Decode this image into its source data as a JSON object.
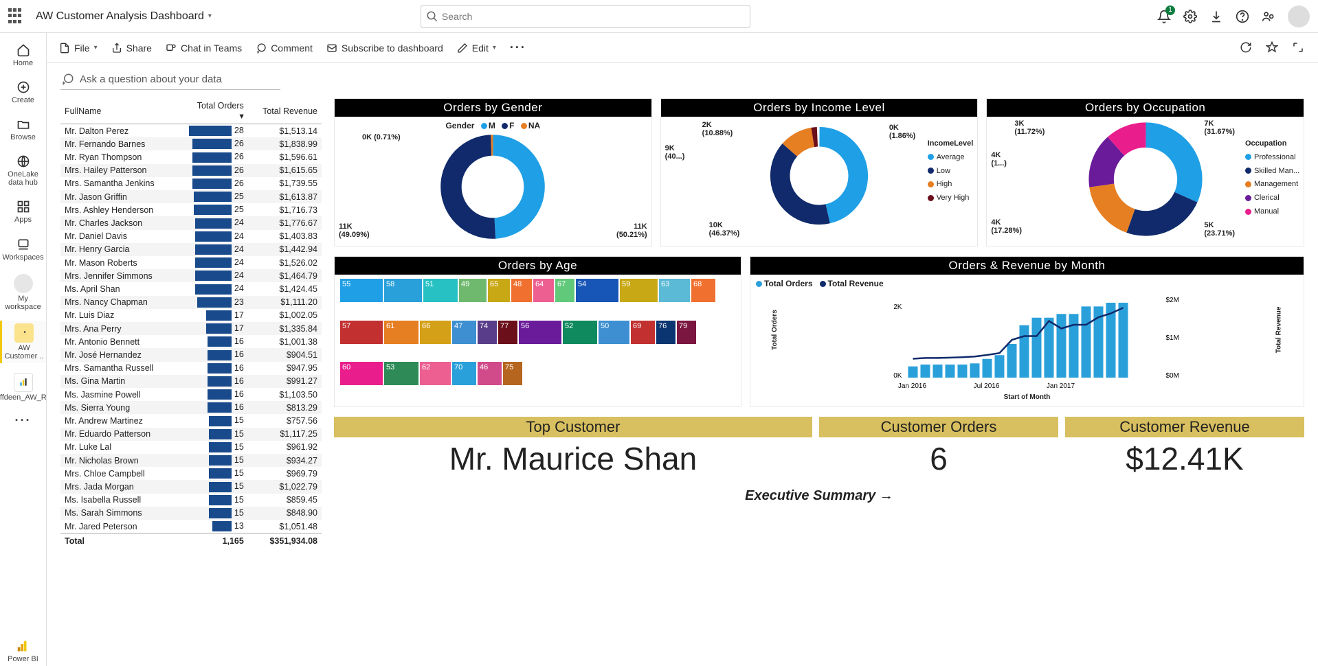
{
  "header": {
    "title": "AW Customer Analysis Dashboard",
    "search_placeholder": "Search",
    "notif_count": "1"
  },
  "leftnav": {
    "home": "Home",
    "create": "Create",
    "browse": "Browse",
    "onelake": "OneLake data hub",
    "apps": "Apps",
    "workspaces": "Workspaces",
    "myws": "My workspace",
    "aw": "AW Customer ..",
    "rep": "Sheriffdeen_AW_Report",
    "powerbi": "Power BI"
  },
  "cmd": {
    "file": "File",
    "share": "Share",
    "chat": "Chat in Teams",
    "comment": "Comment",
    "subscribe": "Subscribe to dashboard",
    "edit": "Edit"
  },
  "qa": "Ask a question about your data",
  "table": {
    "h1": "FullName",
    "h2": "Total Orders",
    "h3": "Total Revenue",
    "rows": [
      [
        "Mr. Dalton Perez",
        "28",
        "$1,513.14"
      ],
      [
        "Mr. Fernando Barnes",
        "26",
        "$1,838.99"
      ],
      [
        "Mr. Ryan Thompson",
        "26",
        "$1,596.61"
      ],
      [
        "Mrs. Hailey Patterson",
        "26",
        "$1,615.65"
      ],
      [
        "Mrs. Samantha Jenkins",
        "26",
        "$1,739.55"
      ],
      [
        "Mr. Jason Griffin",
        "25",
        "$1,613.87"
      ],
      [
        "Mrs. Ashley Henderson",
        "25",
        "$1,716.73"
      ],
      [
        "Mr. Charles Jackson",
        "24",
        "$1,776.67"
      ],
      [
        "Mr. Daniel Davis",
        "24",
        "$1,403.83"
      ],
      [
        "Mr. Henry Garcia",
        "24",
        "$1,442.94"
      ],
      [
        "Mr. Mason Roberts",
        "24",
        "$1,526.02"
      ],
      [
        "Mrs. Jennifer Simmons",
        "24",
        "$1,464.79"
      ],
      [
        "Ms. April Shan",
        "24",
        "$1,424.45"
      ],
      [
        "Mrs. Nancy Chapman",
        "23",
        "$1,111.20"
      ],
      [
        "Mr. Luis Diaz",
        "17",
        "$1,002.05"
      ],
      [
        "Mrs. Ana Perry",
        "17",
        "$1,335.84"
      ],
      [
        "Mr. Antonio Bennett",
        "16",
        "$1,001.38"
      ],
      [
        "Mr. José Hernandez",
        "16",
        "$904.51"
      ],
      [
        "Mrs. Samantha Russell",
        "16",
        "$947.95"
      ],
      [
        "Ms. Gina Martin",
        "16",
        "$991.27"
      ],
      [
        "Ms. Jasmine Powell",
        "16",
        "$1,103.50"
      ],
      [
        "Ms. Sierra Young",
        "16",
        "$813.29"
      ],
      [
        "Mr. Andrew Martinez",
        "15",
        "$757.56"
      ],
      [
        "Mr. Eduardo Patterson",
        "15",
        "$1,117.25"
      ],
      [
        "Mr. Luke Lal",
        "15",
        "$961.92"
      ],
      [
        "Mr. Nicholas Brown",
        "15",
        "$934.27"
      ],
      [
        "Mrs. Chloe Campbell",
        "15",
        "$969.79"
      ],
      [
        "Mrs. Jada Morgan",
        "15",
        "$1,022.79"
      ],
      [
        "Ms. Isabella Russell",
        "15",
        "$859.45"
      ],
      [
        "Ms. Sarah Simmons",
        "15",
        "$848.90"
      ],
      [
        "Mr. Jared Peterson",
        "13",
        "$1,051.48"
      ]
    ],
    "total_label": "Total",
    "total_orders": "1,165",
    "total_rev": "$351,934.08"
  },
  "titles": {
    "gender": "Orders by Gender",
    "income": "Orders by Income Level",
    "occ": "Orders by Occupation",
    "age": "Orders by Age",
    "combo": "Orders & Revenue by Month"
  },
  "gender_legend_label": "Gender",
  "gender_legend": {
    "m": "M",
    "f": "F",
    "na": "NA"
  },
  "gender_labels": {
    "m": "11K\n(49.09%)",
    "f": "11K\n(50.21%)",
    "na": "0K (0.71%)"
  },
  "income_legend_title": "IncomeLevel",
  "income_legend": {
    "avg": "Average",
    "low": "Low",
    "high": "High",
    "vhigh": "Very High"
  },
  "income_labels": {
    "avg": "10K\n(46.37%)",
    "low": "9K\n(40...)",
    "high": "2K\n(10.88%)",
    "vhigh": "0K\n(1.86%)"
  },
  "occ_legend_title": "Occupation",
  "occ_legend": {
    "prof": "Professional",
    "skilled": "Skilled Man...",
    "mgmt": "Management",
    "cler": "Clerical",
    "man": "Manual"
  },
  "occ_labels": {
    "prof": "7K\n(31.67%)",
    "skilled": "5K\n(23.71%)",
    "mgmt": "4K\n(17.28%)",
    "cler": "4K\n(1...)",
    "man": "3K\n(11.72%)"
  },
  "treemap_ages": [
    "55",
    "58",
    "51",
    "49",
    "65",
    "48",
    "64",
    "67",
    "54",
    "59",
    "63",
    "68",
    "57",
    "61",
    "66",
    "47",
    "74",
    "77",
    "56",
    "52",
    "50",
    "69",
    "76",
    "79",
    "60",
    "53",
    "62",
    "70",
    "46",
    "75"
  ],
  "combo": {
    "legend_orders": "Total Orders",
    "legend_rev": "Total Revenue",
    "y1_ticks": [
      "0K",
      "2K"
    ],
    "y2_ticks": [
      "$0M",
      "$1M",
      "$2M"
    ],
    "x_ticks": [
      "Jan 2016",
      "Jul 2016",
      "Jan 2017"
    ],
    "xlabel": "Start of Month",
    "y1label": "Total Orders",
    "y2label": "Total Revenue"
  },
  "gold": {
    "top_title": "Top Customer",
    "top_val": "Mr. Maurice Shan",
    "orders_title": "Customer Orders",
    "orders_val": "6",
    "rev_title": "Customer Revenue",
    "rev_val": "$12.41K",
    "exec": "Executive Summary"
  },
  "chart_data": [
    {
      "type": "pie",
      "title": "Orders by Gender",
      "series": [
        {
          "name": "M",
          "value": 11000,
          "pct": 49.09
        },
        {
          "name": "F",
          "value": 11000,
          "pct": 50.21
        },
        {
          "name": "NA",
          "value": 0,
          "pct": 0.71
        }
      ]
    },
    {
      "type": "pie",
      "title": "Orders by Income Level",
      "series": [
        {
          "name": "Average",
          "value": 10000,
          "pct": 46.37
        },
        {
          "name": "Low",
          "value": 9000,
          "pct": 40.0
        },
        {
          "name": "High",
          "value": 2000,
          "pct": 10.88
        },
        {
          "name": "Very High",
          "value": 0,
          "pct": 1.86
        }
      ]
    },
    {
      "type": "pie",
      "title": "Orders by Occupation",
      "series": [
        {
          "name": "Professional",
          "value": 7000,
          "pct": 31.67
        },
        {
          "name": "Skilled Manual",
          "value": 5000,
          "pct": 23.71
        },
        {
          "name": "Management",
          "value": 4000,
          "pct": 17.28
        },
        {
          "name": "Clerical",
          "value": 4000,
          "pct": 15.62
        },
        {
          "name": "Manual",
          "value": 3000,
          "pct": 11.72
        }
      ]
    },
    {
      "type": "treemap",
      "title": "Orders by Age",
      "categories": [
        "55",
        "58",
        "51",
        "49",
        "65",
        "48",
        "64",
        "67",
        "54",
        "59",
        "63",
        "68",
        "57",
        "61",
        "66",
        "47",
        "74",
        "77",
        "56",
        "52",
        "50",
        "69",
        "76",
        "79",
        "60",
        "53",
        "62",
        "70",
        "46",
        "75"
      ]
    },
    {
      "type": "bar+line",
      "title": "Orders & Revenue by Month",
      "x": [
        "Jan 2016",
        "Feb 2016",
        "Mar 2016",
        "Apr 2016",
        "May 2016",
        "Jun 2016",
        "Jul 2016",
        "Aug 2016",
        "Sep 2016",
        "Oct 2016",
        "Nov 2016",
        "Dec 2016",
        "Jan 2017",
        "Feb 2017",
        "Mar 2017",
        "Apr 2017",
        "May 2017",
        "Jun 2017"
      ],
      "series": [
        {
          "name": "Total Orders",
          "type": "bar",
          "values": [
            300,
            350,
            350,
            350,
            350,
            380,
            500,
            600,
            900,
            1400,
            1600,
            1600,
            1700,
            1700,
            1900,
            1900,
            2000,
            2000
          ]
        },
        {
          "name": "Total Revenue",
          "type": "line",
          "values": [
            500000,
            520000,
            520000,
            530000,
            540000,
            560000,
            600000,
            650000,
            1000000,
            1100000,
            1100000,
            1500000,
            1300000,
            1400000,
            1400000,
            1600000,
            1700000,
            1850000
          ]
        }
      ],
      "y1label": "Total Orders",
      "y2label": "Total Revenue",
      "xlabel": "Start of Month",
      "y1lim": [
        0,
        2000
      ],
      "y2lim": [
        0,
        2000000
      ]
    }
  ]
}
